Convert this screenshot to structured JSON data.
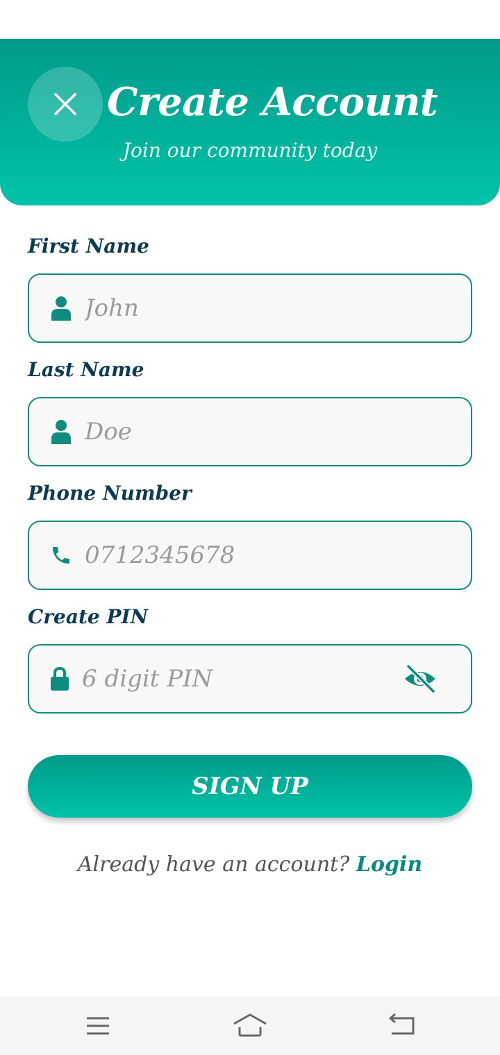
{
  "header": {
    "title": "Create Account",
    "subtitle": "Join our community today",
    "close_icon": "close-icon"
  },
  "form": {
    "first_name": {
      "label": "First Name",
      "placeholder": "John",
      "value": "",
      "icon": "person-icon"
    },
    "last_name": {
      "label": "Last Name",
      "placeholder": "Doe",
      "value": "",
      "icon": "person-icon"
    },
    "phone": {
      "label": "Phone Number",
      "placeholder": "0712345678",
      "value": "",
      "icon": "phone-icon"
    },
    "pin": {
      "label": "Create PIN",
      "placeholder": "6 digit PIN",
      "value": "",
      "icon": "lock-icon",
      "visibility_icon": "eye-off-icon"
    }
  },
  "signup_button": {
    "label": "SIGN UP"
  },
  "login_prompt": {
    "text": "Already have an account?",
    "link": "Login"
  },
  "navbar": {
    "items": [
      "menu-icon",
      "home-icon",
      "back-icon"
    ]
  },
  "colors": {
    "primary": "#009a8a",
    "primary_light": "#00c3a8",
    "label_text": "#0d3b52",
    "field_border": "#0f8c7d",
    "placeholder": "#9a9a9a",
    "link": "#0a8a7e"
  }
}
